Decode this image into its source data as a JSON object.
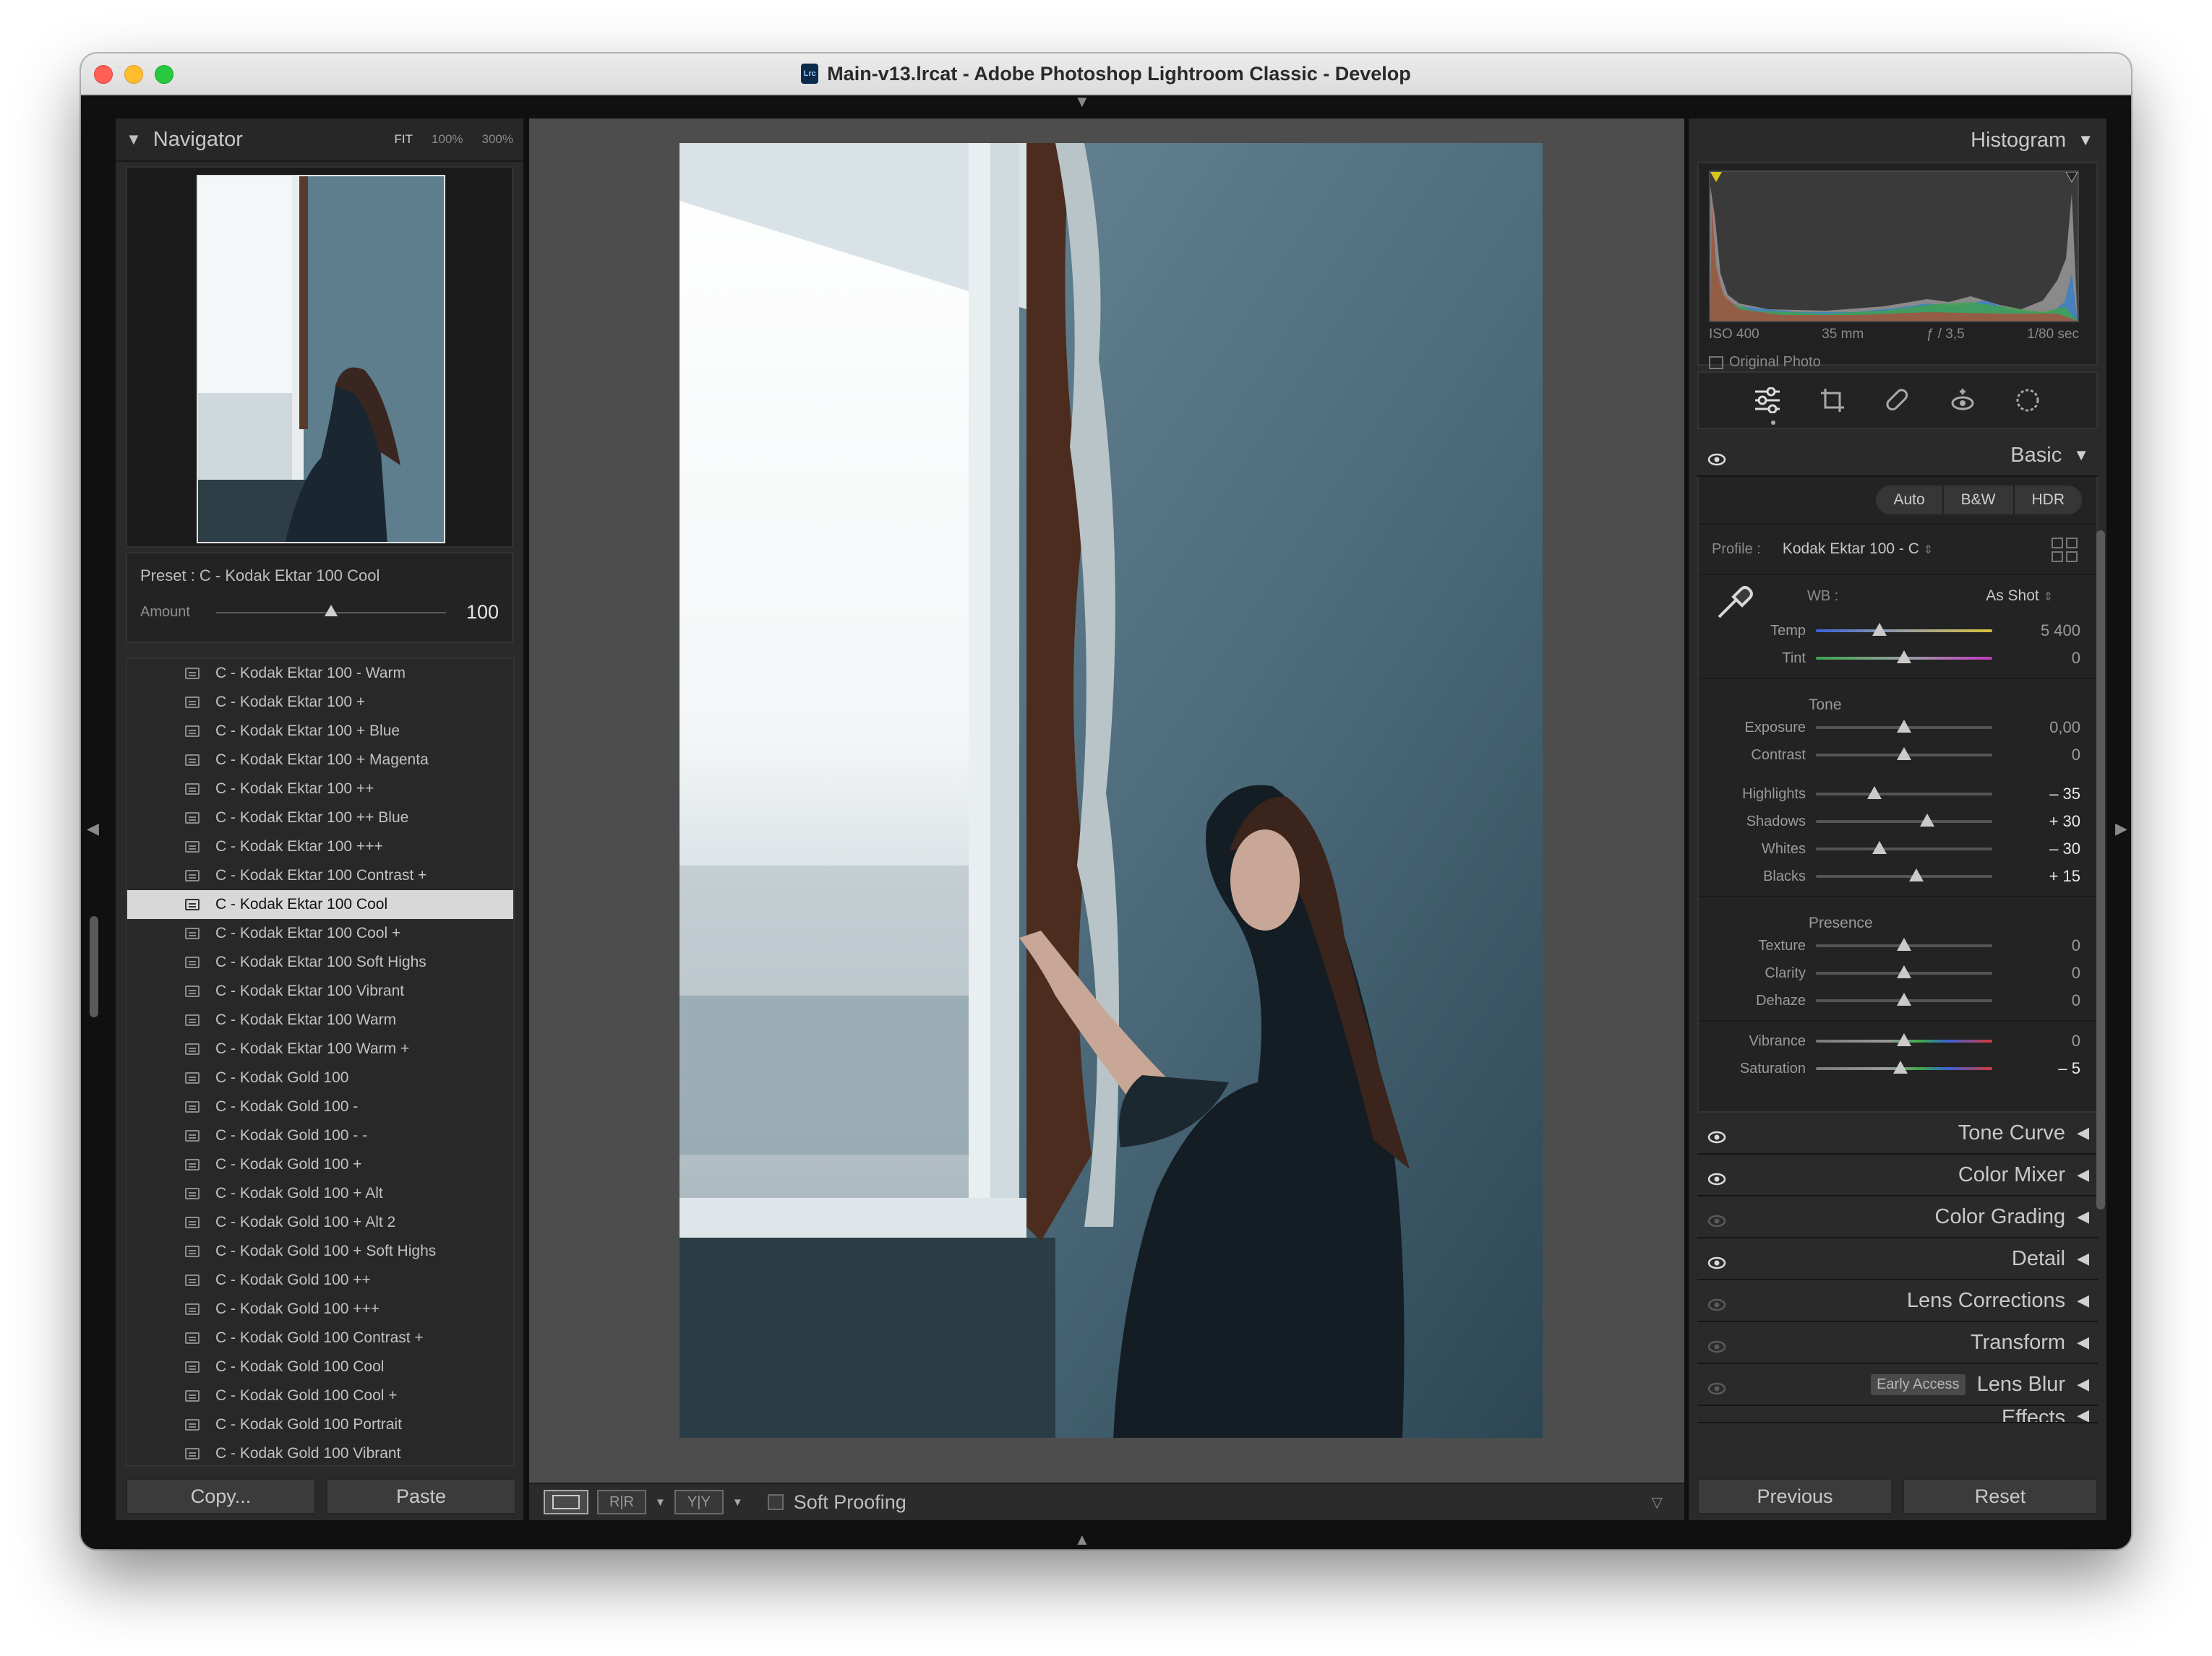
{
  "window": {
    "title": "Main-v13.lrcat - Adobe Photoshop Lightroom Classic - Develop",
    "app_icon": "Lrc"
  },
  "navigator": {
    "title": "Navigator",
    "zoom": [
      "FIT",
      "100%",
      "300%"
    ],
    "preset_line": "Preset : C - Kodak Ektar 100 Cool",
    "amount_label": "Amount",
    "amount_value": "100",
    "amount_fraction": 0.5
  },
  "presets": [
    "C - Kodak Ektar 100 - Warm",
    "C - Kodak Ektar 100 +",
    "C - Kodak Ektar 100 + Blue",
    "C - Kodak Ektar 100 + Magenta",
    "C - Kodak Ektar 100 ++",
    "C - Kodak Ektar 100 ++ Blue",
    "C - Kodak Ektar 100 +++",
    "C - Kodak Ektar 100 Contrast +",
    "C - Kodak Ektar 100 Cool",
    "C - Kodak Ektar 100 Cool +",
    "C - Kodak Ektar 100 Soft Highs",
    "C - Kodak Ektar 100 Vibrant",
    "C - Kodak Ektar 100 Warm",
    "C - Kodak Ektar 100 Warm +",
    "C - Kodak Gold 100",
    "C - Kodak Gold 100 -",
    "C - Kodak Gold 100 - -",
    "C - Kodak Gold 100 +",
    "C - Kodak Gold 100 + Alt",
    "C - Kodak Gold 100 + Alt 2",
    "C - Kodak Gold 100 + Soft Highs",
    "C - Kodak Gold 100 ++",
    "C - Kodak Gold 100 +++",
    "C - Kodak Gold 100 Contrast +",
    "C - Kodak Gold 100 Cool",
    "C - Kodak Gold 100 Cool +",
    "C - Kodak Gold 100 Portrait",
    "C - Kodak Gold 100 Vibrant"
  ],
  "selected_preset_index": 8,
  "left_buttons": {
    "copy": "Copy...",
    "paste": "Paste"
  },
  "toolbar": {
    "view1": "",
    "view2": "R|R",
    "view3": "Y|Y",
    "soft_proofing": "Soft Proofing"
  },
  "histogram": {
    "title": "Histogram",
    "iso": "ISO 400",
    "focal": "35 mm",
    "aperture": "ƒ / 3,5",
    "shutter": "1/80 sec",
    "original_photo": "Original Photo"
  },
  "basic": {
    "title": "Basic",
    "buttons": [
      "Auto",
      "B&W",
      "HDR"
    ],
    "profile_label": "Profile :",
    "profile_value": "Kodak Ektar 100 - C",
    "wb_label": "WB :",
    "wb_value": "As Shot",
    "wb_sliders": [
      {
        "label": "Temp",
        "value": "5 400",
        "pos": 0.36,
        "kind": "temp"
      },
      {
        "label": "Tint",
        "value": "0",
        "pos": 0.5,
        "kind": "tint"
      }
    ],
    "tone_label": "Tone",
    "tone_sliders": [
      {
        "label": "Exposure",
        "value": "0,00",
        "pos": 0.5
      },
      {
        "label": "Contrast",
        "value": "0",
        "pos": 0.5
      }
    ],
    "tone_sliders2": [
      {
        "label": "Highlights",
        "value": "– 35",
        "pos": 0.33,
        "changed": true
      },
      {
        "label": "Shadows",
        "value": "+ 30",
        "pos": 0.63,
        "changed": true
      },
      {
        "label": "Whites",
        "value": "– 30",
        "pos": 0.36,
        "changed": true
      },
      {
        "label": "Blacks",
        "value": "+ 15",
        "pos": 0.57,
        "changed": true
      }
    ],
    "presence_label": "Presence",
    "presence_sliders": [
      {
        "label": "Texture",
        "value": "0",
        "pos": 0.5
      },
      {
        "label": "Clarity",
        "value": "0",
        "pos": 0.5
      },
      {
        "label": "Dehaze",
        "value": "0",
        "pos": 0.5
      }
    ],
    "color_sliders": [
      {
        "label": "Vibrance",
        "value": "0",
        "pos": 0.5,
        "kind": "vib"
      },
      {
        "label": "Saturation",
        "value": "– 5",
        "pos": 0.48,
        "kind": "sat",
        "changed": true
      }
    ]
  },
  "sections": [
    {
      "label": "Tone Curve",
      "eye": true
    },
    {
      "label": "Color Mixer",
      "eye": true
    },
    {
      "label": "Color Grading",
      "eye": false
    },
    {
      "label": "Detail",
      "eye": true
    },
    {
      "label": "Lens Corrections",
      "eye": false
    },
    {
      "label": "Transform",
      "eye": false
    },
    {
      "label": "Lens Blur",
      "eye": false,
      "badge": "Early Access"
    },
    {
      "label": "Effects",
      "eye": false
    }
  ],
  "right_buttons": {
    "previous": "Previous",
    "reset": "Reset"
  },
  "colors": {
    "selected_bg": "#d8d8d8",
    "panel_bg": "#2a2a2a",
    "center_bg": "#4d4d4d"
  }
}
